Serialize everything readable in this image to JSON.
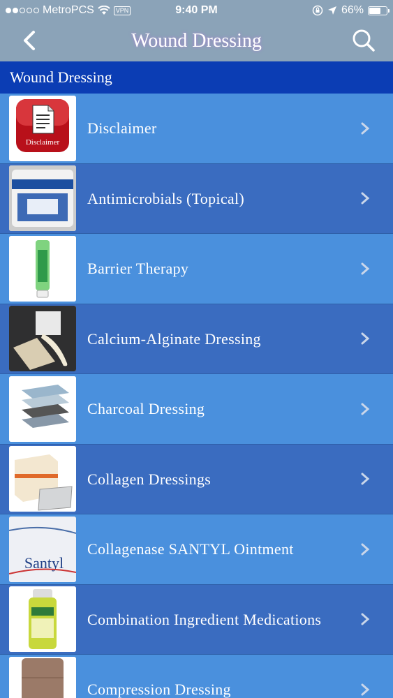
{
  "status": {
    "carrier": "MetroPCS",
    "vpn": "VPN",
    "time": "9:40 PM",
    "battery": "66%",
    "battery_level": 0.66
  },
  "nav": {
    "title": "Wound Dressing",
    "back_icon": "chevron-left-icon",
    "search_icon": "search-icon"
  },
  "section": {
    "title": "Wound Dressing"
  },
  "items": [
    {
      "label": "Disclaimer",
      "thumb_text": "Disclaimer"
    },
    {
      "label": "Antimicrobials (Topical)"
    },
    {
      "label": "Barrier Therapy"
    },
    {
      "label": "Calcium-Alginate Dressing"
    },
    {
      "label": "Charcoal Dressing"
    },
    {
      "label": "Collagen Dressings"
    },
    {
      "label": "Collagenase SANTYL Ointment",
      "thumb_text": "Santyl"
    },
    {
      "label": "Combination Ingredient Medications"
    },
    {
      "label": "Compression Dressing"
    }
  ]
}
